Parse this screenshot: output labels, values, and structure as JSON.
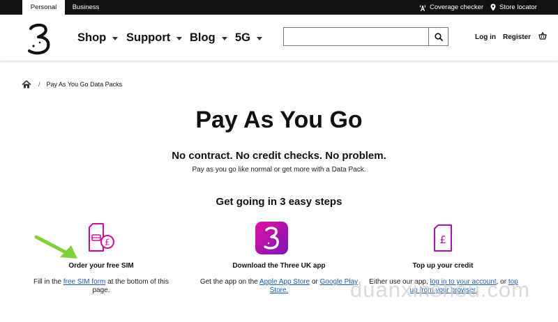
{
  "topbar": {
    "tabs": [
      {
        "label": "Personal",
        "active": true
      },
      {
        "label": "Business",
        "active": false
      }
    ],
    "coverage_label": "Coverage checker",
    "store_label": "Store locator"
  },
  "nav": {
    "items": [
      {
        "label": "Shop"
      },
      {
        "label": "Support"
      },
      {
        "label": "Blog"
      },
      {
        "label": "5G"
      }
    ],
    "search_value": "",
    "login_label": "Log in",
    "register_label": "Register"
  },
  "breadcrumb": {
    "separator": "/",
    "current": "Pay As You Go Data Packs"
  },
  "main": {
    "title": "Pay As You Go",
    "subtitle": "No contract. No credit checks. No problem.",
    "description": "Pay as you go like normal or get more with a Data Pack.",
    "steps_heading": "Get going in 3 easy steps"
  },
  "steps": [
    {
      "title": "Order your free SIM",
      "text_before": "Fill in the ",
      "link1": "free SIM form",
      "text_after": " at the bottom of this page."
    },
    {
      "title": "Download the Three UK app",
      "text_before": "Get the app on the ",
      "link1": "Apple App Store",
      "text_middle": " or ",
      "link2": "Google Play Store."
    },
    {
      "title": "Top up your credit",
      "text_before": "Either use our app, ",
      "link1": "log in to your account",
      "text_middle": ", or ",
      "link2": "top up from your browser."
    }
  ],
  "watermark": "duanxinshou.com",
  "colors": {
    "brand_magenta": "#d10a9b",
    "brand_purple": "#8a14a8",
    "arrow_green": "#7fd23c",
    "link_blue": "#1a5fb4",
    "topbar_bg": "#111111"
  }
}
